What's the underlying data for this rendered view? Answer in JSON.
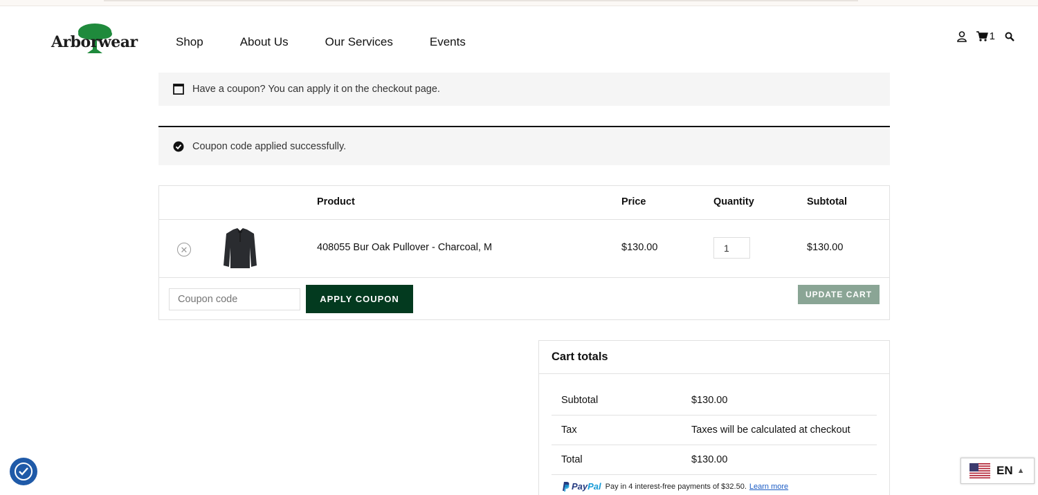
{
  "header": {
    "logo_text": "Arborwear",
    "nav": [
      "Shop",
      "About Us",
      "Our Services",
      "Events"
    ],
    "cart_count": "1"
  },
  "notices": {
    "coupon_hint": "Have a coupon? You can apply it on the checkout page.",
    "coupon_success": "Coupon code applied successfully."
  },
  "cart": {
    "headers": {
      "product": "Product",
      "price": "Price",
      "quantity": "Quantity",
      "subtotal": "Subtotal"
    },
    "items": [
      {
        "name": "408055 Bur Oak Pullover - Charcoal, M",
        "price": "$130.00",
        "quantity": "1",
        "subtotal": "$130.00"
      }
    ],
    "coupon_placeholder": "Coupon code",
    "apply_coupon_label": "APPLY COUPON",
    "update_cart_label": "UPDATE CART"
  },
  "totals": {
    "title": "Cart totals",
    "subtotal_label": "Subtotal",
    "subtotal_value": "$130.00",
    "tax_label": "Tax",
    "tax_value": "Taxes will be calculated at checkout",
    "total_label": "Total",
    "total_value": "$130.00",
    "paypal_brand_1": "Pay",
    "paypal_brand_2": "Pal",
    "paypal_text": "Pay in 4 interest-free payments of $32.50.",
    "paypal_link": "Learn more"
  },
  "language": {
    "code": "EN"
  },
  "colors": {
    "brand_green": "#033a1f",
    "update_button": "#8aa595",
    "logo_tree": "#1f8a3c",
    "a11y_blue": "#1f5aa8"
  }
}
